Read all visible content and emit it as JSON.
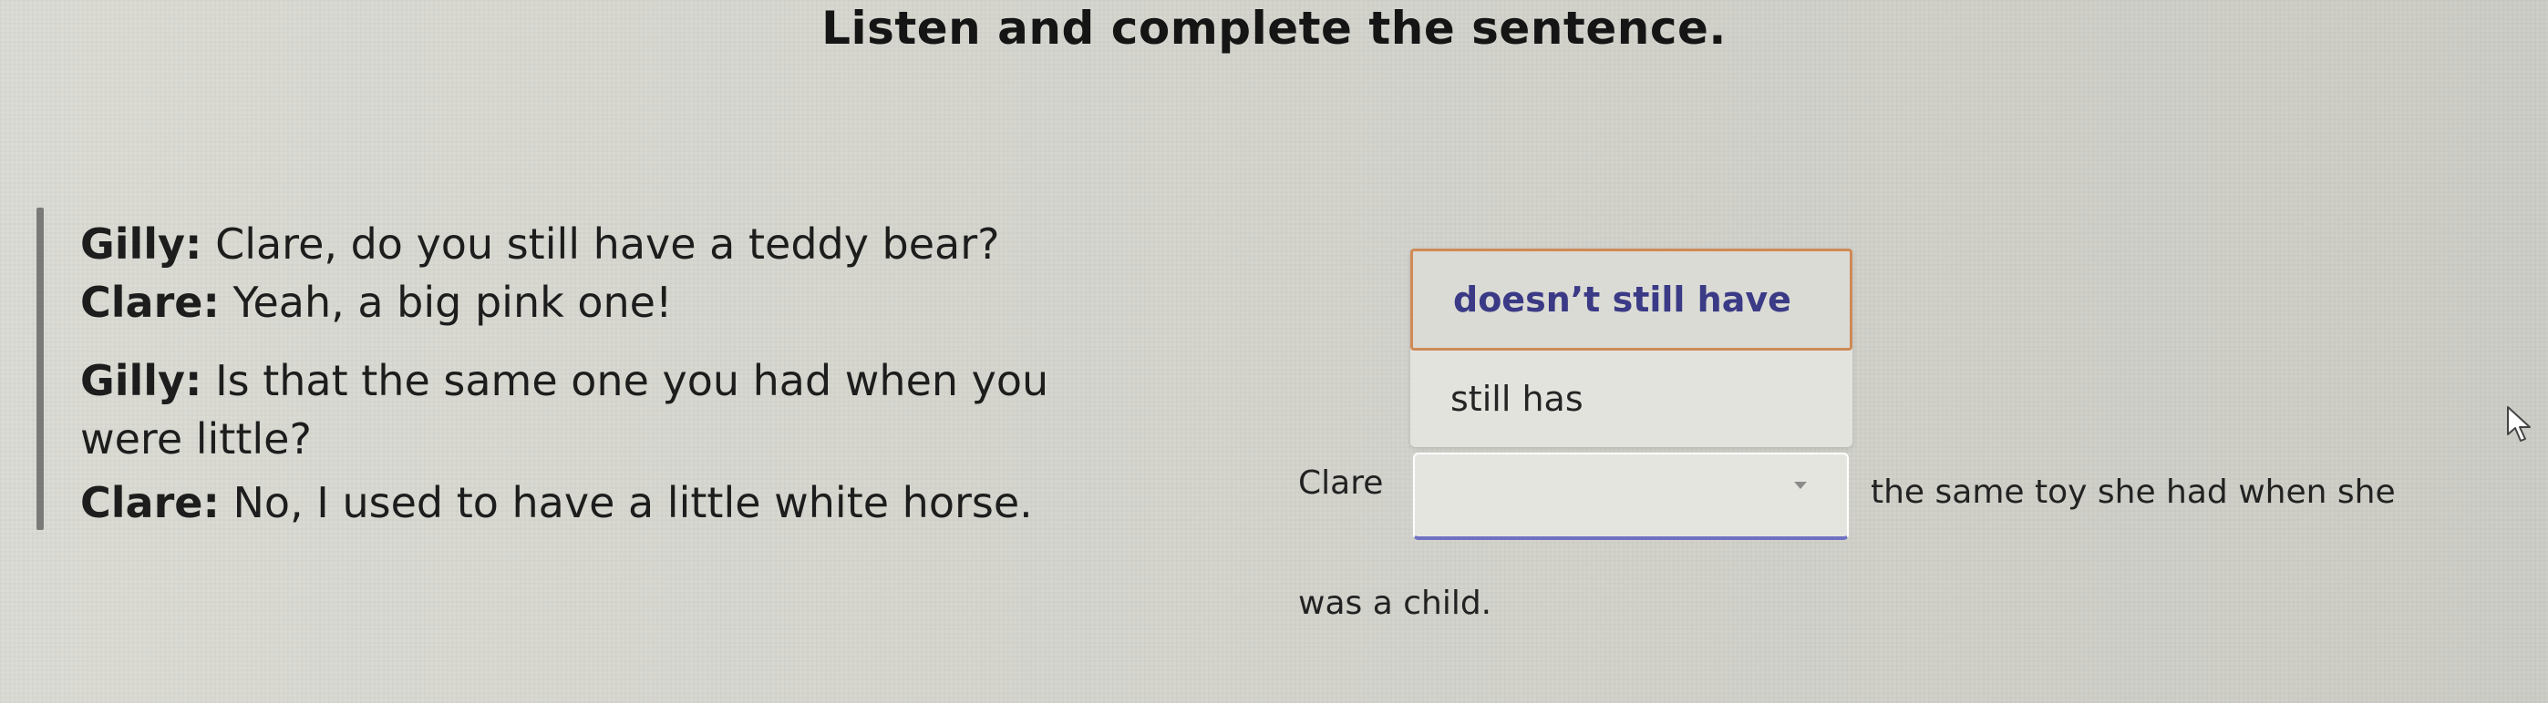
{
  "header": {
    "title": "Listen and complete the sentence."
  },
  "dialogue": [
    {
      "speaker": "Gilly:",
      "text": " Clare, do you still have a teddy bear?"
    },
    {
      "speaker": "Clare:",
      "text": " Yeah, a big pink one!"
    },
    {
      "speaker": "Gilly:",
      "text": " Is that the same one you had when you"
    },
    {
      "speaker": "",
      "text": "were little?"
    },
    {
      "speaker": "Clare:",
      "text": " No, I used to have a little white horse."
    }
  ],
  "question": {
    "before": "Clare",
    "after": "the same toy she had when she",
    "line2": "was a child.",
    "options": [
      "doesn’t still have",
      "still has"
    ],
    "selected_value": ""
  },
  "icons": {
    "dropdown": "chevron-down-icon",
    "pointer": "mouse-pointer-icon"
  }
}
